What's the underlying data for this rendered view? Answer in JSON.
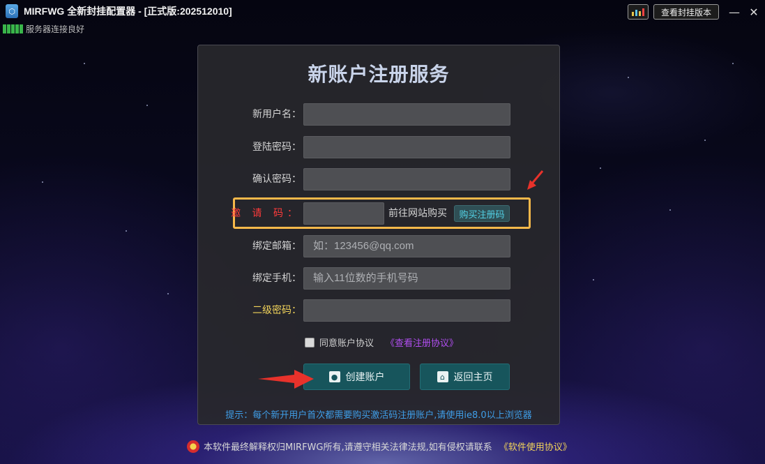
{
  "window": {
    "title": "MIRFWG 全新封挂配置器 - [正式版:202512010]",
    "version_button": "查看封挂版本",
    "minimize": "—",
    "close": "✕"
  },
  "status": {
    "text": "服务器连接良好"
  },
  "form": {
    "title": "新账户注册服务",
    "fields": [
      {
        "label": "新用户名：",
        "placeholder": ""
      },
      {
        "label": "登陆密码：",
        "placeholder": ""
      },
      {
        "label": "确认密码：",
        "placeholder": ""
      },
      {
        "label": "邀 请 码：",
        "placeholder": ""
      },
      {
        "label": "绑定邮箱：",
        "placeholder": "如：123456@qq.com"
      },
      {
        "label": "绑定手机：",
        "placeholder": "输入11位数的手机号码"
      },
      {
        "label": "二级密码：",
        "placeholder": ""
      }
    ],
    "buy_prompt": "前往网站购买",
    "buy_button": "购买注册码",
    "agree_label": "同意账户协议",
    "agree_link": "《查看注册协议》",
    "create_button": "创建账户",
    "home_button": "返回主页",
    "tip": "提示：每个新开用户首次都需要购买激活码注册账户,请使用ie8.0以上浏览器"
  },
  "footer": {
    "text": "本软件最终解释权归MIRFWG所有,请遵守相关法律法规,如有侵权请联系",
    "link": "《软件使用协议》"
  },
  "colors": {
    "accent_highlight": "#f6b84a",
    "invite_label": "#ff3b3b",
    "secondary_password_label": "#f1d35a",
    "button_bg": "#17555c",
    "tip_text": "#3f9ee8",
    "agree_link": "#b14ef0"
  },
  "icons": {
    "app": "app-logo-icon",
    "chart": "chart-bars-icon",
    "user": "user-icon",
    "home": "home-icon",
    "signal": "signal-bars-icon",
    "emblem": "police-emblem-icon",
    "arrow": "red-arrow-icon"
  }
}
